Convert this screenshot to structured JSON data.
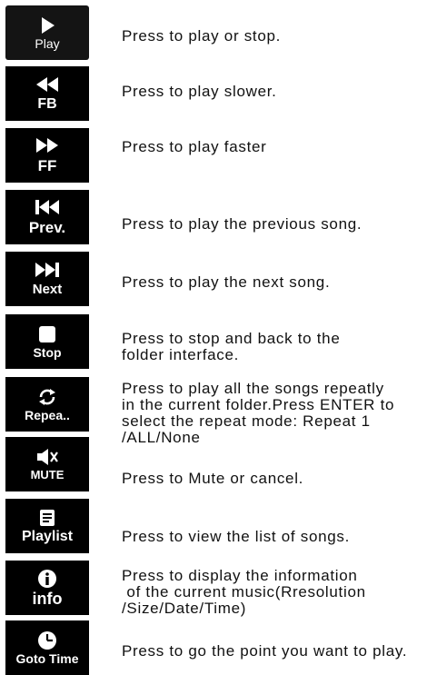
{
  "items": [
    {
      "label": "Play",
      "icon": "play-icon",
      "desc": [
        "Press to play or stop."
      ]
    },
    {
      "label": "FB",
      "icon": "fast-backward-icon",
      "desc": [
        "Press to play slower."
      ]
    },
    {
      "label": "FF",
      "icon": "fast-forward-icon",
      "desc": [
        "Press to play faster"
      ]
    },
    {
      "label": "Prev.",
      "icon": "previous-track-icon",
      "desc": [
        "Press to play the previous song."
      ]
    },
    {
      "label": "Next",
      "icon": "next-track-icon",
      "desc": [
        "Press to play the next song."
      ]
    },
    {
      "label": "Stop",
      "icon": "stop-icon",
      "desc": [
        "Press to stop and back to the",
        "folder interface."
      ]
    },
    {
      "label": "Repea..",
      "icon": "repeat-icon",
      "desc": [
        "Press to play all the songs repeatly",
        "in the current folder.Press ENTER to",
        "select the repeat mode: Repeat 1",
        "/ALL/None"
      ]
    },
    {
      "label": "MUTE",
      "icon": "mute-speaker-icon",
      "desc": [
        "Press to Mute or cancel."
      ]
    },
    {
      "label": "Playlist",
      "icon": "playlist-icon",
      "desc": [
        "Press to view the list of songs."
      ]
    },
    {
      "label": "info",
      "icon": "info-icon",
      "desc": [
        "Press to display the information",
        " of the current music(Rresolution",
        "/Size/Date/Time)"
      ]
    },
    {
      "label": "Goto Time",
      "icon": "clock-icon",
      "desc": [
        "Press to go the point you want to play."
      ]
    }
  ]
}
